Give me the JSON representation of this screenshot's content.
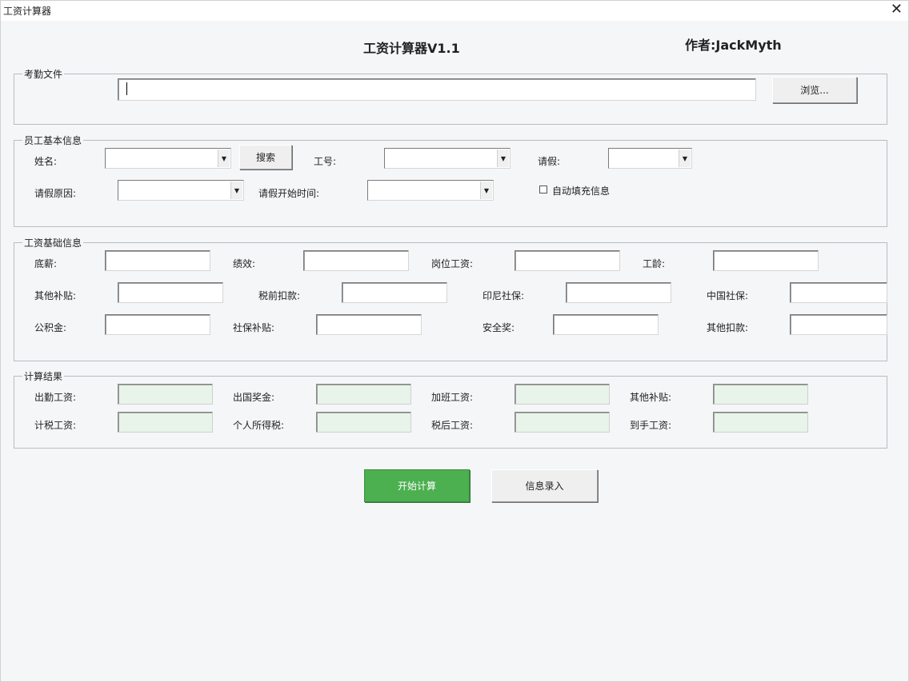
{
  "window": {
    "title": "工资计算器",
    "close_glyph": "✕"
  },
  "header": {
    "title": "工资计算器V1.1",
    "author": "作者:JackMyth"
  },
  "attendance": {
    "legend": "考勤文件",
    "file_value": "",
    "browse_label": "浏览..."
  },
  "employee": {
    "legend": "员工基本信息",
    "name_label": "姓名:",
    "search_label": "搜索",
    "id_label": "工号:",
    "leave_label": "请假:",
    "leave_reason_label": "请假原因:",
    "leave_start_label": "请假开始时间:",
    "autofill_label": "自动填充信息",
    "autofill_checked": false
  },
  "salary": {
    "legend": "工资基础信息",
    "base_label": "底薪:",
    "perf_label": "绩效:",
    "post_label": "岗位工资:",
    "seniority_label": "工龄:",
    "other_allowance_label": "其他补贴:",
    "pretax_deduct_label": "税前扣款:",
    "indo_social_label": "印尼社保:",
    "china_social_label": "中国社保:",
    "housing_fund_label": "公积金:",
    "social_allowance_label": "社保补贴:",
    "safety_bonus_label": "安全奖:",
    "other_deduct_label": "其他扣款:"
  },
  "result": {
    "legend": "计算结果",
    "attend_pay_label": "出勤工资:",
    "abroad_bonus_label": "出国奖金:",
    "overtime_pay_label": "加班工资:",
    "other_allowance_label": "其他补贴:",
    "taxable_pay_label": "计税工资:",
    "income_tax_label": "个人所得税:",
    "after_tax_label": "税后工资:",
    "net_pay_label": "到手工资:"
  },
  "actions": {
    "start_label": "开始计算",
    "entry_label": "信息录入"
  },
  "colors": {
    "primary": "#4caf50",
    "result_field": "#e8f4e9",
    "background": "#f5f6f8"
  }
}
